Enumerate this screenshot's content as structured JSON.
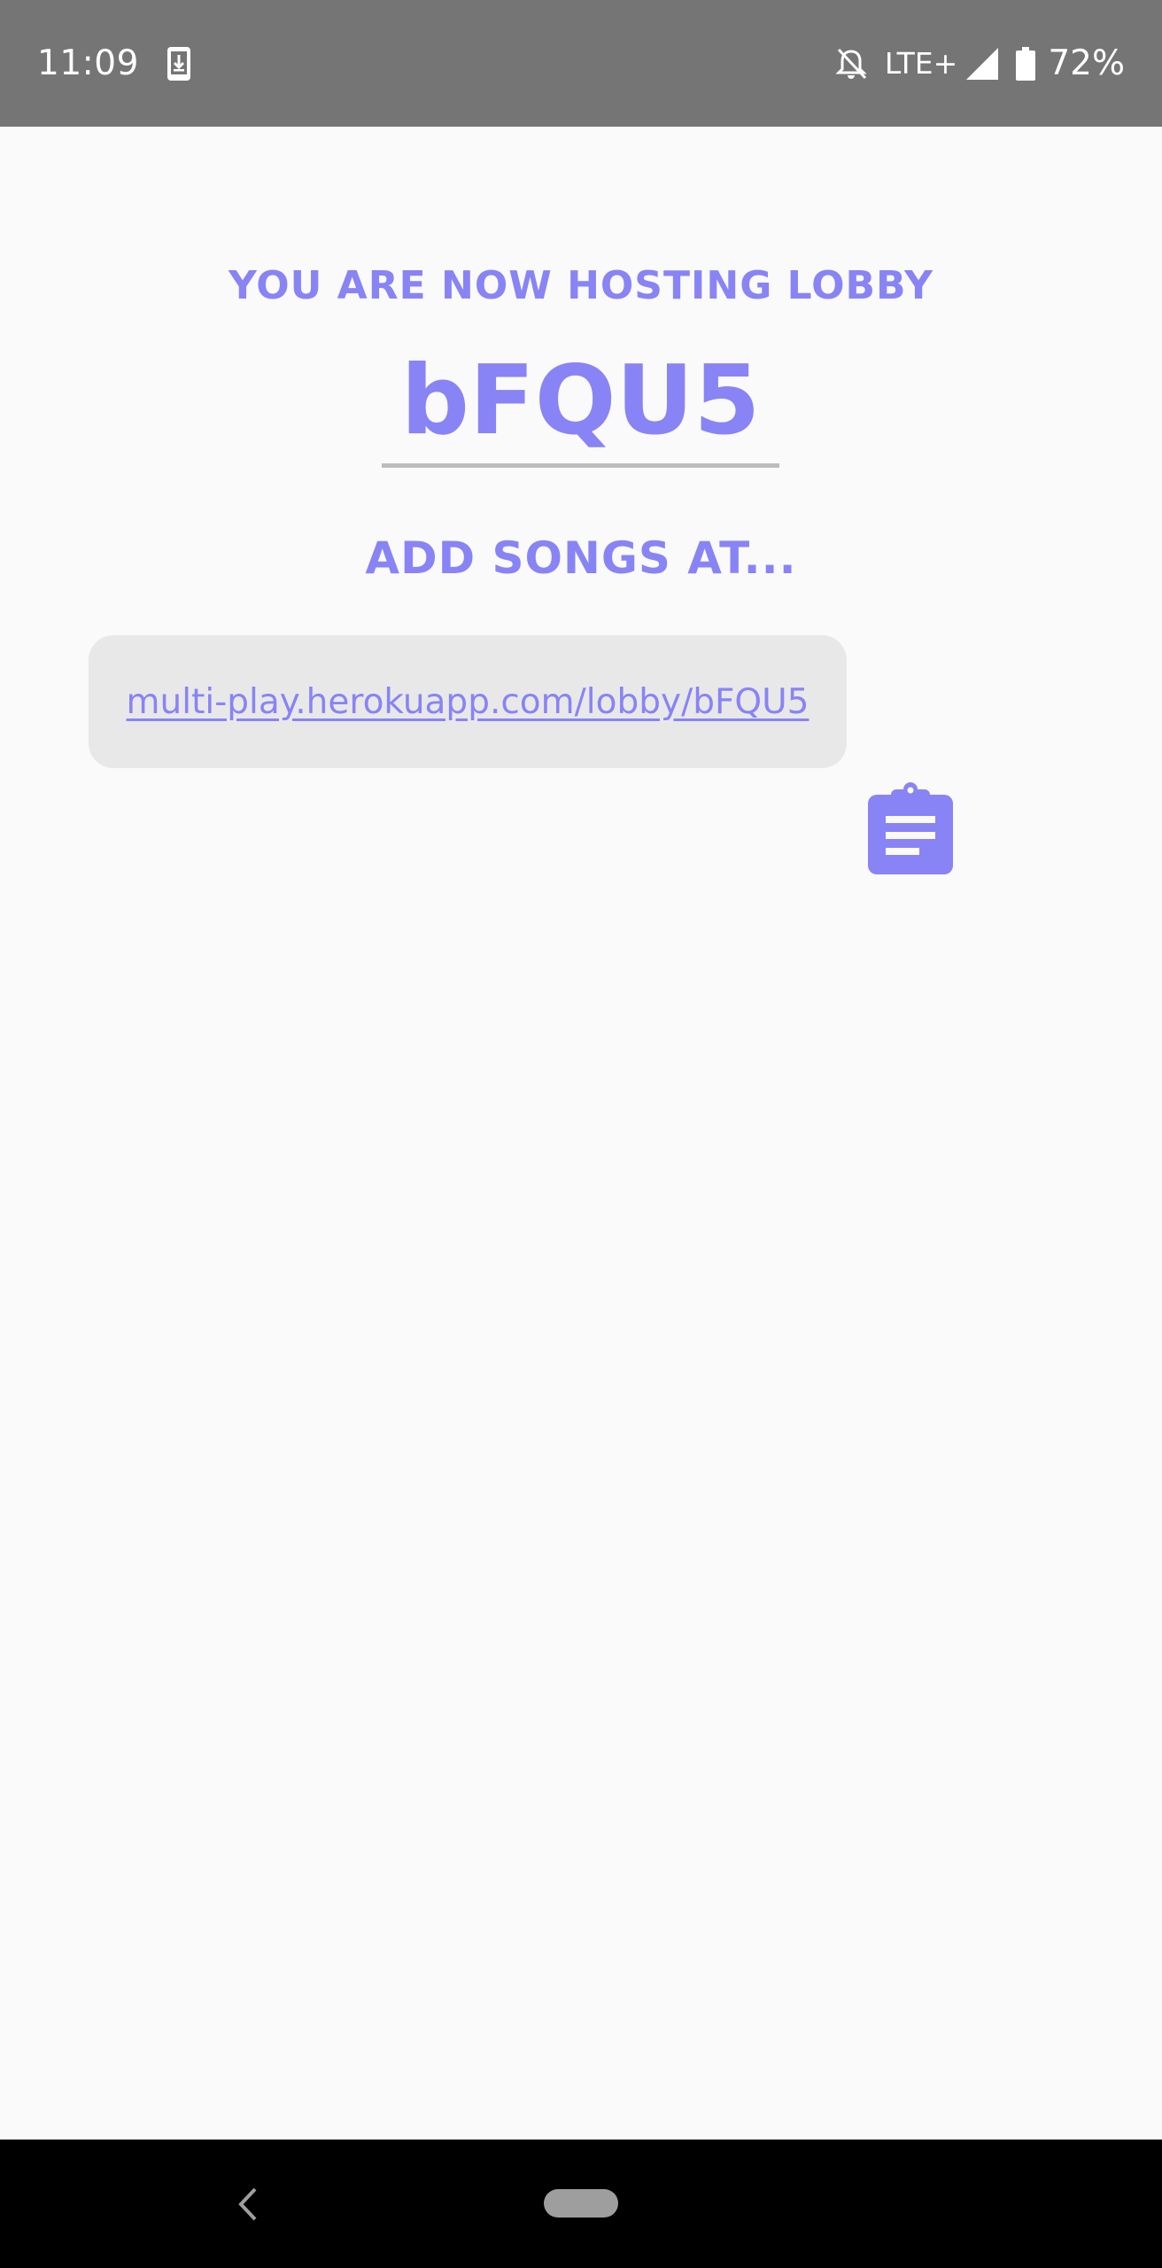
{
  "status_bar": {
    "time": "11:09",
    "network": "LTE+",
    "battery": "72%",
    "icons": [
      "download-notification-icon",
      "notifications-off-icon",
      "cell-signal-icon",
      "battery-icon"
    ]
  },
  "lobby": {
    "hosting_label": "YOU ARE NOW HOSTING LOBBY",
    "code": "bFQU5",
    "add_songs_label": "ADD SONGS AT...",
    "link": "multi-play.herokuapp.com/lobby/bFQU5",
    "copy_icon": "clipboard-icon"
  },
  "nav_bar": {
    "icons": [
      "back-icon",
      "home-pill-icon"
    ]
  },
  "colors": {
    "accent": "#8884f5",
    "status_bar": "#757575",
    "background": "#fafafa",
    "link_box": "#e8e8e8",
    "underline": "#bdbdbd"
  }
}
